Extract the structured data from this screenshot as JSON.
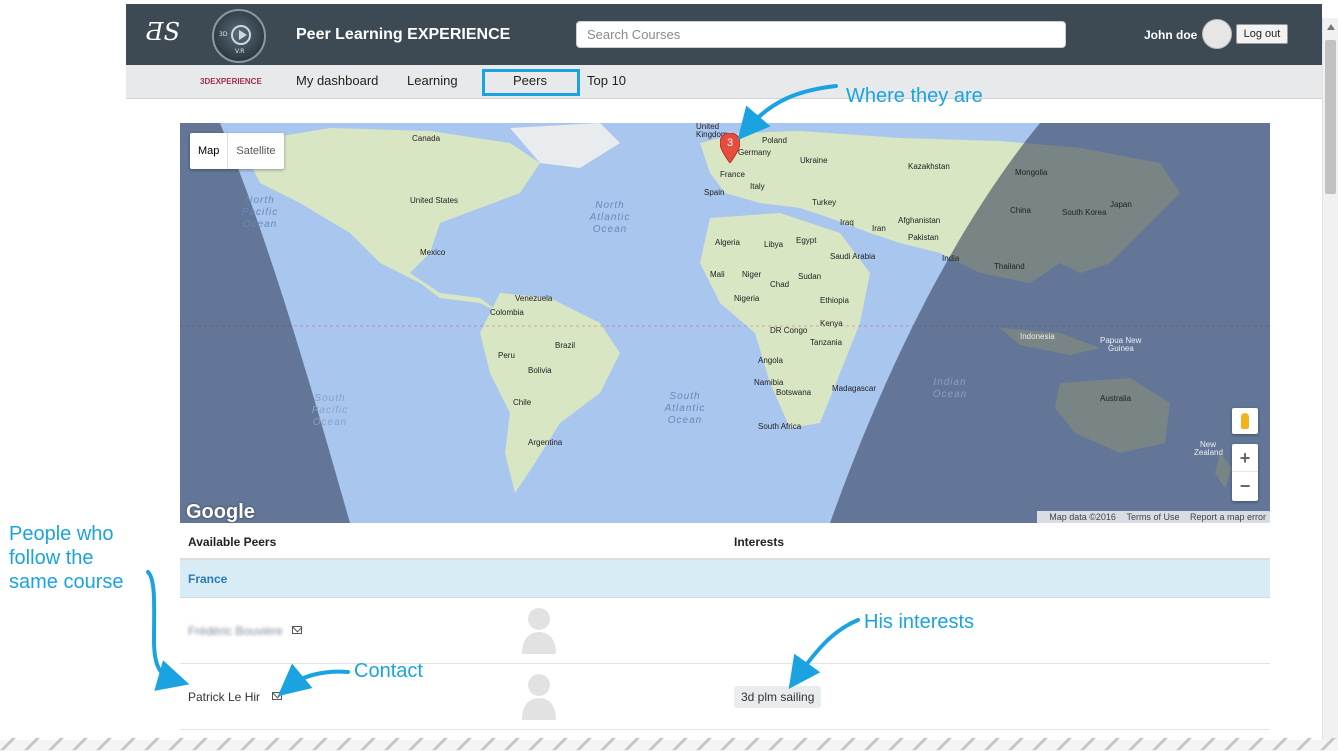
{
  "header": {
    "app_title": "Peer Learning EXPERIENCE",
    "search_placeholder": "Search Courses",
    "user_name": "John doe",
    "logout_label": "Log out",
    "compass_top_left": "3D",
    "compass_bottom": "V.R",
    "brand_label": "3DEXPERIENCE"
  },
  "nav": {
    "items": [
      "My dashboard",
      "Learning",
      "Peers",
      "Top 10"
    ],
    "active": "Peers"
  },
  "map": {
    "type_buttons": [
      "Map",
      "Satellite"
    ],
    "active_type": "Map",
    "marker_count": "3",
    "ocean_labels": {
      "north_pacific_l": "North Pacific Ocean",
      "north_atlantic": "North Atlantic Ocean",
      "south_pacific": "South Pacific Ocean",
      "south_atlantic": "South Atlantic Ocean",
      "indian": "Indian Ocean"
    },
    "country_labels": [
      "Canada",
      "United States",
      "Mexico",
      "Venezuela",
      "Colombia",
      "Peru",
      "Brazil",
      "Bolivia",
      "Chile",
      "Argentina",
      "United Kingdom",
      "Poland",
      "Germany",
      "Ukraine",
      "France",
      "Italy",
      "Spain",
      "Kazakhstan",
      "Mongolia",
      "Turkey",
      "Iraq",
      "Iran",
      "Afghanistan",
      "Pakistan",
      "China",
      "South Korea",
      "Japan",
      "Algeria",
      "Libya",
      "Egypt",
      "Saudi Arabia",
      "India",
      "Thailand",
      "Mali",
      "Niger",
      "Chad",
      "Sudan",
      "Nigeria",
      "Ethiopia",
      "Kenya",
      "DR Congo",
      "Tanzania",
      "Angola",
      "Namibia",
      "Botswana",
      "Madagascar",
      "South Africa",
      "Indonesia",
      "Papua New Guinea",
      "Australia",
      "New Zealand"
    ],
    "zoom_in": "+",
    "zoom_out": "−",
    "google": "Google",
    "attribution": [
      "Map data ©2016",
      "Terms of Use",
      "Report a map error"
    ],
    "accent_water": "#a9c6ef",
    "accent_land": "#d8e6c4",
    "accent_night": "#4b5b7a"
  },
  "table": {
    "col_peers": "Available Peers",
    "col_interests": "Interests",
    "group": "France",
    "rows": [
      {
        "name": "Frédéric Bouvière",
        "name_blurred": true,
        "interests": ""
      },
      {
        "name": "Patrick Le Hir",
        "name_blurred": false,
        "interests": "3d plm sailing"
      }
    ]
  },
  "annotations": {
    "where": "Where they are",
    "people": [
      "People who",
      "follow the",
      "same course"
    ],
    "interests": "His interests",
    "contact": "Contact"
  },
  "colors": {
    "topbar": "#3e4a53",
    "annotation": "#1aa3e0",
    "group_row": "#d8ecf5",
    "group_text": "#2a7ab8"
  }
}
